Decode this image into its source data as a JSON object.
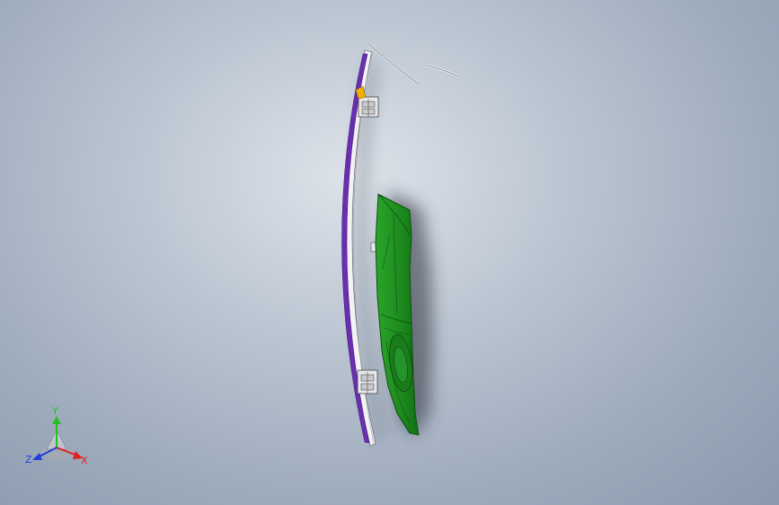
{
  "viewport": {
    "background_top": "#dde3ea",
    "background_bottom": "#8a99ad"
  },
  "model": {
    "frame_color": "#6a2fb0",
    "frame_edge_color": "#f2f2f4",
    "panel_color": "#1f8a1f",
    "panel_dark": "#0f4f12",
    "bracket_color": "#e8e8e8",
    "accent_color": "#f0b000"
  },
  "triad": {
    "x_label": "X",
    "y_label": "Y",
    "z_label": "Z",
    "x_color": "#e02020",
    "y_color": "#20c020",
    "z_color": "#2040e0"
  }
}
